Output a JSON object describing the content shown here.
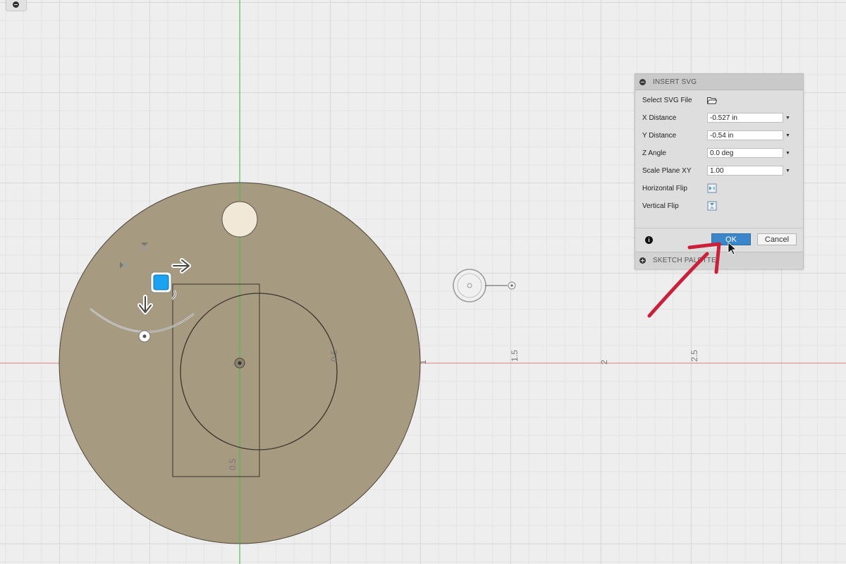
{
  "canvas": {
    "ruler_labels": [
      "0.5",
      "1",
      "1.5",
      "2",
      "2.5",
      "0.5"
    ],
    "colors": {
      "grid": "#d8d8d8",
      "x_axis": "#e88a8a",
      "y_axis": "#43c043",
      "body_fill": "#a69a80",
      "hole_fill": "#f2e8d8",
      "handle_blue": "#1aa3f0",
      "annotation_arrow": "#cc1f3a"
    }
  },
  "dialog": {
    "title": "INSERT SVG",
    "rows": [
      {
        "label": "Select SVG File",
        "icon": "folder-open-icon"
      },
      {
        "label": "X Distance",
        "value": "-0.527 in"
      },
      {
        "label": "Y Distance",
        "value": "-0.54 in"
      },
      {
        "label": "Z Angle",
        "value": "0.0 deg"
      },
      {
        "label": "Scale Plane XY",
        "value": "1.00"
      },
      {
        "label": "Horizontal Flip",
        "icon": "horizontal-flip-icon"
      },
      {
        "label": "Vertical Flip",
        "icon": "vertical-flip-icon"
      }
    ],
    "ok_label": "OK",
    "cancel_label": "Cancel",
    "info_icon": "i"
  },
  "sketch_palette": {
    "label": "SKETCH PALETTE"
  }
}
